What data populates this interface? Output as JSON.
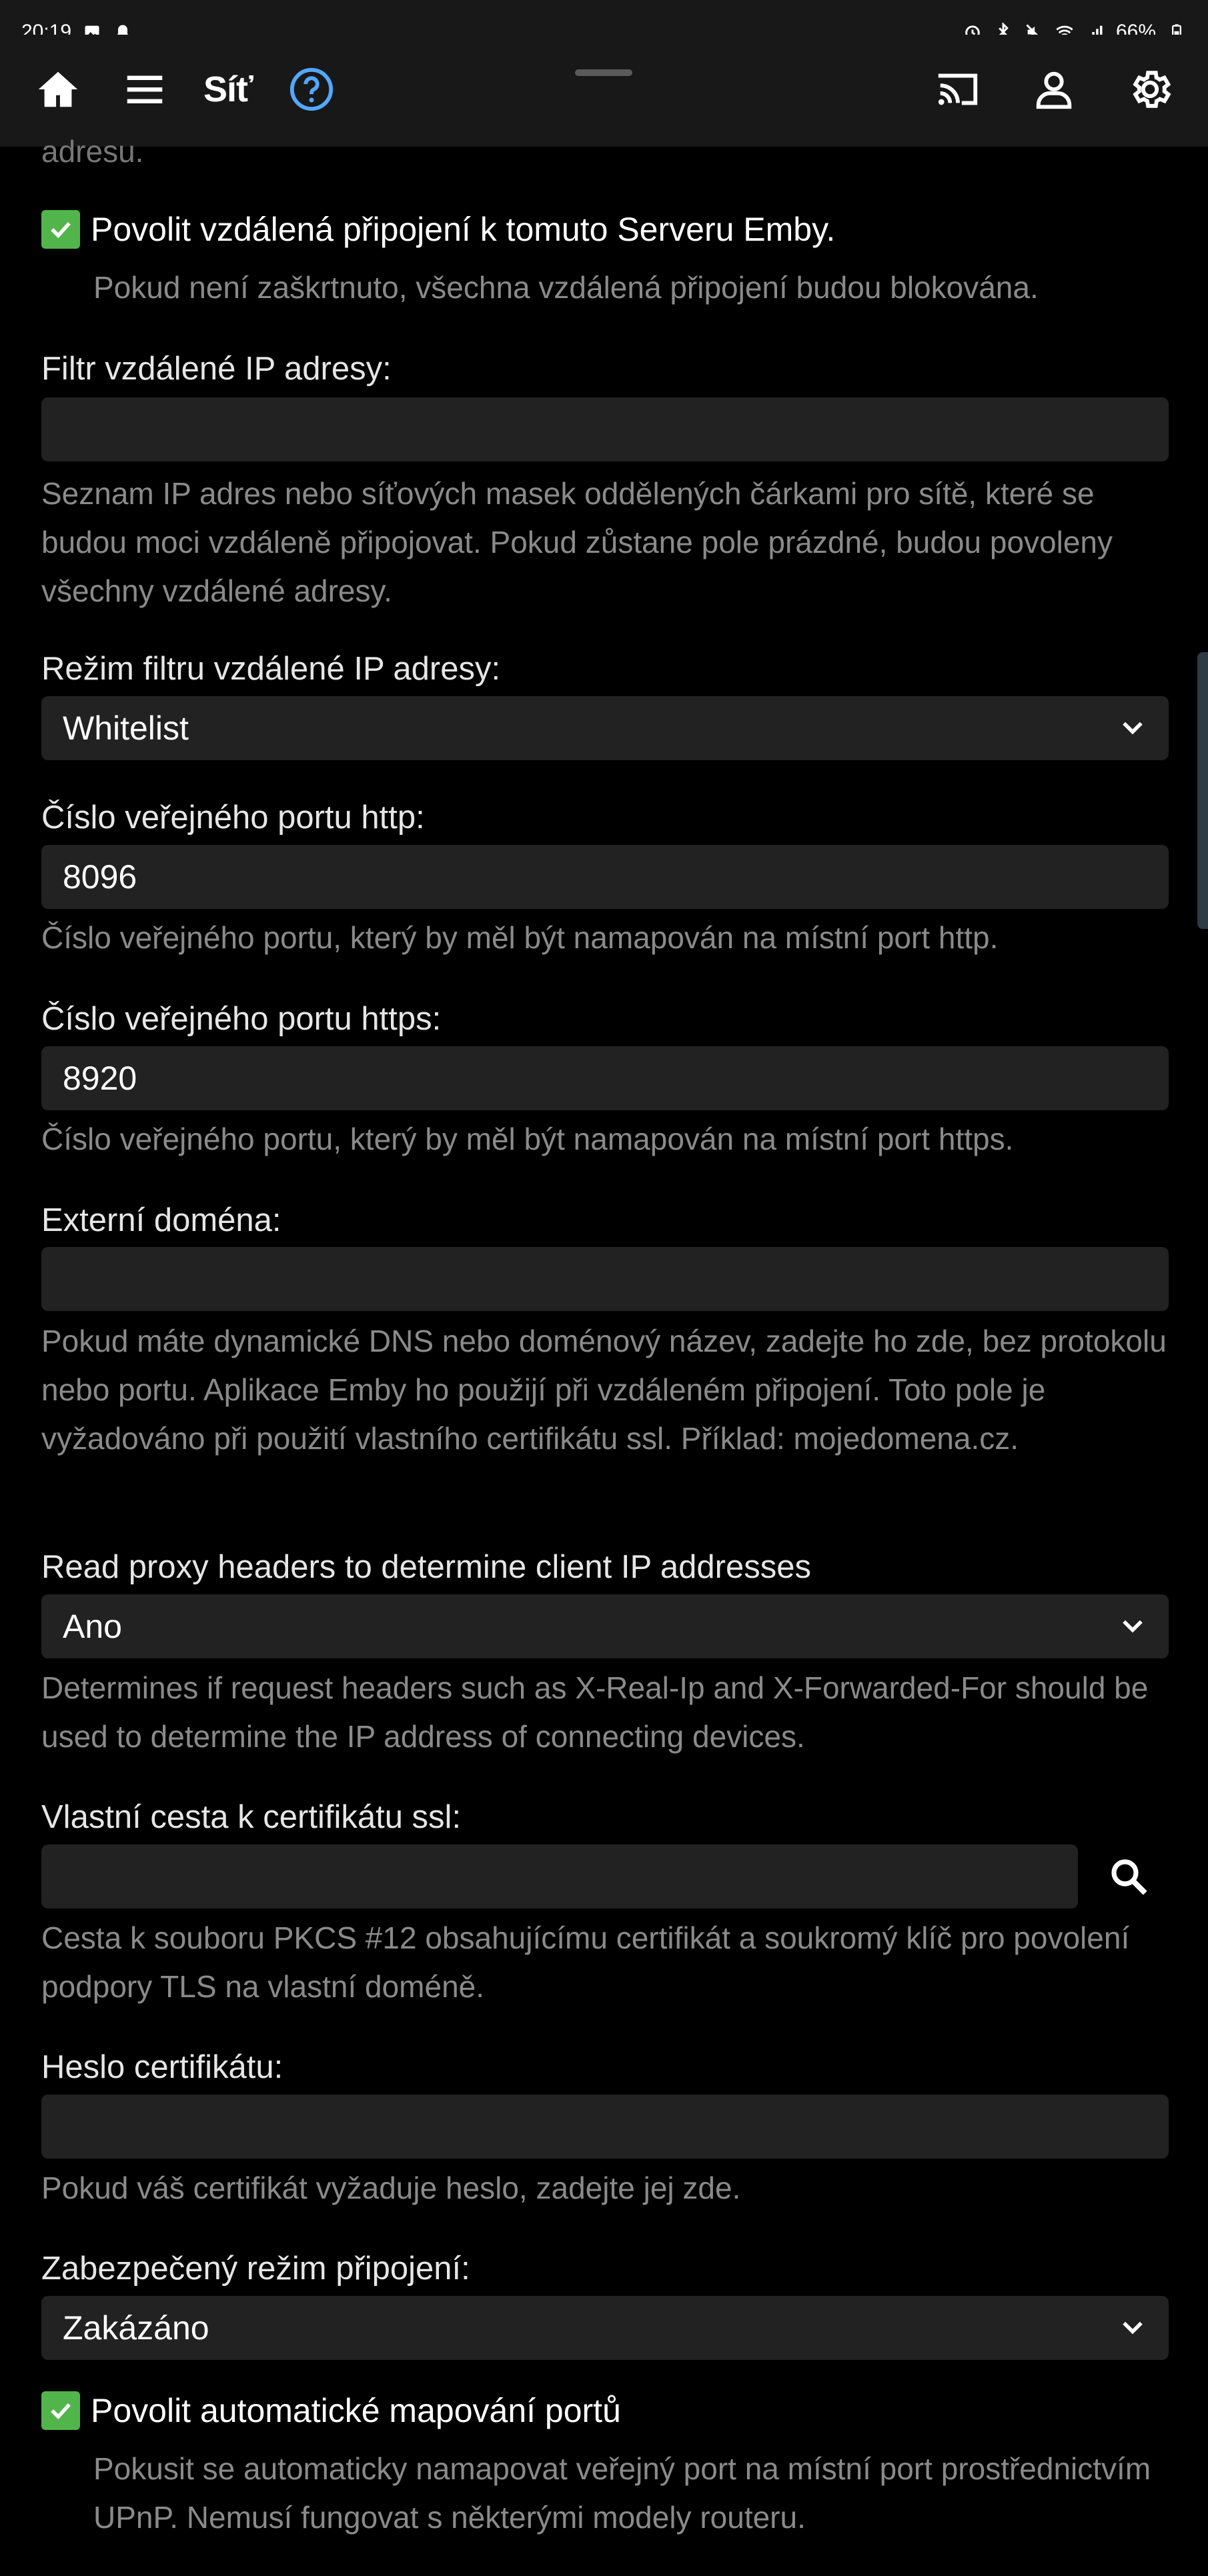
{
  "status_bar": {
    "time": "20:19",
    "battery": "66%",
    "left_icons": [
      "image-icon",
      "bell-icon"
    ],
    "right_icons": [
      "alarm-icon",
      "bluetooth-icon",
      "mute-icon",
      "wifi-icon",
      "signal-icon",
      "battery-icon"
    ]
  },
  "header": {
    "title": "Síť",
    "icons": [
      "home-icon",
      "menu-icon",
      "help-icon",
      "cast-icon",
      "user-icon",
      "settings-icon"
    ],
    "accent_color": "#52a8ff"
  },
  "fragment_text": "adresu.",
  "remote_access": {
    "label": "Povolit vzdálená připojení k tomuto Serveru Emby.",
    "checked": true,
    "help": "Pokud není zaškrtnuto, všechna vzdálená připojení budou blokována."
  },
  "ip_filter": {
    "label": "Filtr vzdálené IP adresy:",
    "value": "",
    "help": "Seznam IP adres nebo síťových masek oddělených čárkami pro sítě, které se budou moci vzdáleně připojovat. Pokud zůstane pole prázdné, budou povoleny všechny vzdálené adresy."
  },
  "ip_filter_mode": {
    "label": "Režim filtru vzdálené IP adresy:",
    "value": "Whitelist"
  },
  "http_port": {
    "label": "Číslo veřejného portu http:",
    "value": "8096",
    "help": "Číslo veřejného portu, který by měl být namapován na místní port http."
  },
  "https_port": {
    "label": "Číslo veřejného portu https:",
    "value": "8920",
    "help": "Číslo veřejného portu, který by měl být namapován na místní port https."
  },
  "external_domain": {
    "label": "Externí doména:",
    "value": "",
    "help": "Pokud máte dynamické DNS nebo doménový název, zadejte ho zde, bez protokolu nebo portu. Aplikace Emby ho použijí při vzdáleném připojení. Toto pole je vyžadováno při použití vlastního certifikátu ssl. Příklad: mojedomena.cz."
  },
  "proxy_headers": {
    "label": "Read proxy headers to determine client IP addresses",
    "value": "Ano",
    "help": "Determines if request headers such as X-Real-Ip and X-Forwarded-For should be used to determine the IP address of connecting devices."
  },
  "ssl_path": {
    "label": "Vlastní cesta k certifikátu ssl:",
    "value": "",
    "help": "Cesta k souboru PKCS #12 obsahujícímu certifikát a soukromý klíč pro povolení podpory TLS na vlastní doméně."
  },
  "cert_password": {
    "label": "Heslo certifikátu:",
    "value": "",
    "help": "Pokud váš certifikát vyžaduje heslo, zadejte jej zde."
  },
  "secure_mode": {
    "label": "Zabezpečený režim připojení:",
    "value": "Zakázáno"
  },
  "upnp": {
    "label": "Povolit automatické mapování portů",
    "checked": true,
    "help": "Pokusit se automaticky namapovat veřejný port na místní port prostřednictvím UPnP. Nemusí fungovat s některými modely routeru."
  },
  "colors": {
    "background": "#000000",
    "input_background": "#222222",
    "checkbox": "#52b54b",
    "help_text": "#8a8a8a"
  }
}
